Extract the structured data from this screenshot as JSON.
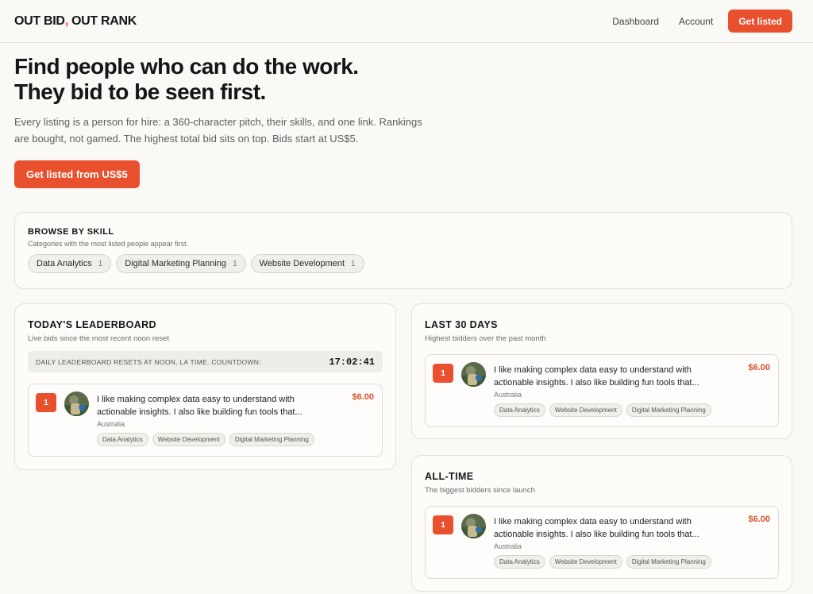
{
  "brand": {
    "part1": "OUT BID",
    "comma": ",",
    "part2": " OUT RANK"
  },
  "nav": {
    "dashboard": "Dashboard",
    "account": "Account",
    "cta": "Get listed"
  },
  "hero": {
    "title_line1": "Find people who can do the work.",
    "title_line2": "They bid to be seen first.",
    "description": "Every listing is a person for hire: a 360-character pitch, their skills, and one link. Rankings are bought, not gamed. The highest total bid sits on top. Bids start at US$5.",
    "cta": "Get listed from US$5"
  },
  "skills": {
    "title": "BROWSE BY SKILL",
    "subtitle": "Categories with the most listed people appear first.",
    "chips": [
      {
        "label": "Data Analytics",
        "count": "1"
      },
      {
        "label": "Digital Marketing Planning",
        "count": "1"
      },
      {
        "label": "Website Development",
        "count": "1"
      }
    ]
  },
  "colors": {
    "accent": "#e8502e",
    "background": "#faf9f5"
  },
  "today": {
    "title": "TODAY'S LEADERBOARD",
    "subtitle": "Live bids since the most recent noon reset",
    "countdown_label": "DAILY LEADERBOARD RESETS AT NOON, LA TIME. COUNTDOWN:",
    "countdown_value": "17:02:41",
    "entry": {
      "rank": "1",
      "pitch_line1": "I like making complex data easy to understand with",
      "pitch_line2": "actionable insights. I also like building fun tools that...",
      "location": "Australia",
      "amount": "$6.00",
      "tags": [
        "Data Analytics",
        "Website Development",
        "Digital Marketing Planning"
      ]
    }
  },
  "last30": {
    "title": "LAST 30 DAYS",
    "subtitle": "Highest bidders over the past month",
    "entry": {
      "rank": "1",
      "pitch_line1": "I like making complex data easy to understand with",
      "pitch_line2": "actionable insights. I also like building fun tools that...",
      "location": "Australia",
      "amount": "$6.00",
      "tags": [
        "Data Analytics",
        "Website Development",
        "Digital Marketing Planning"
      ]
    }
  },
  "alltime": {
    "title": "ALL-TIME",
    "subtitle": "The biggest bidders since launch",
    "entry": {
      "rank": "1",
      "pitch_line1": "I like making complex data easy to understand with",
      "pitch_line2": "actionable insights. I also like building fun tools that...",
      "location": "Australia",
      "amount": "$6.00",
      "tags": [
        "Data Analytics",
        "Website Development",
        "Digital Marketing Planning"
      ]
    }
  }
}
